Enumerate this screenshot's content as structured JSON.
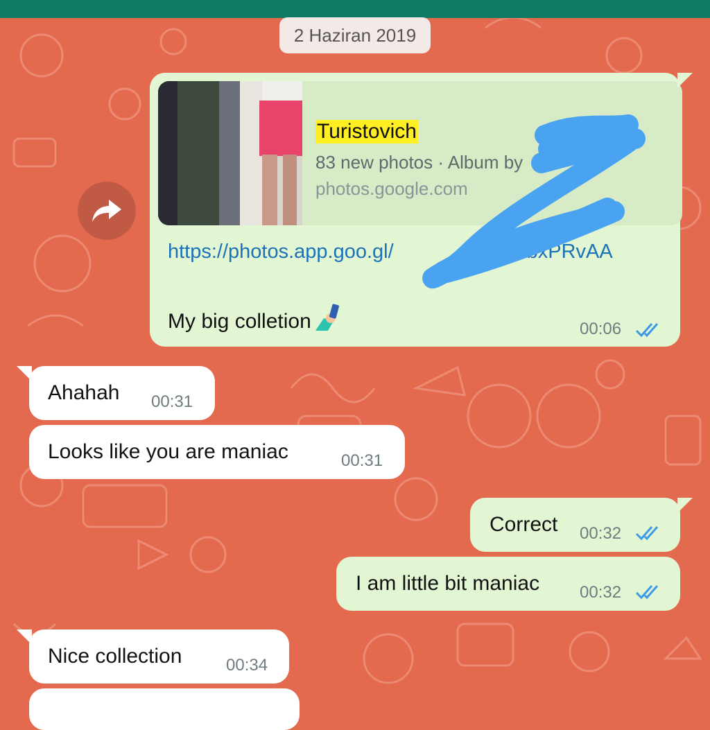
{
  "date_chip": "2 Haziran 2019",
  "messages": {
    "m1": {
      "preview_title": "Turistovich",
      "preview_subtitle": "83 new photos · Album by",
      "preview_domain": "photos.google.com",
      "link": "https://photos.app.goo.gl/",
      "link_tail": "UwbxPRvAA",
      "text": "My big colletion",
      "time": "00:06",
      "status": "read"
    },
    "m2": {
      "text": "Ahahah",
      "time": "00:31"
    },
    "m3": {
      "text": "Looks like you are maniac",
      "time": "00:31"
    },
    "m4": {
      "text": "Correct",
      "time": "00:32",
      "status": "read"
    },
    "m5": {
      "text": "I am little bit maniac",
      "time": "00:32",
      "status": "read"
    },
    "m6": {
      "text": "Nice collection",
      "time": "00:34"
    }
  },
  "icons": {
    "forward": "forward-arrow-icon",
    "ticks": "double-check-icon",
    "emoji": "person-with-phone-emoji"
  },
  "colors": {
    "wallpaper": "#e46a4f",
    "top_bar": "#0f7a63",
    "incoming_bubble": "#ffffff",
    "outgoing_bubble": "#e3f6d3",
    "read_ticks": "#3d9ae8",
    "link": "#1b72b8",
    "scribble": "#4aa3f0"
  }
}
